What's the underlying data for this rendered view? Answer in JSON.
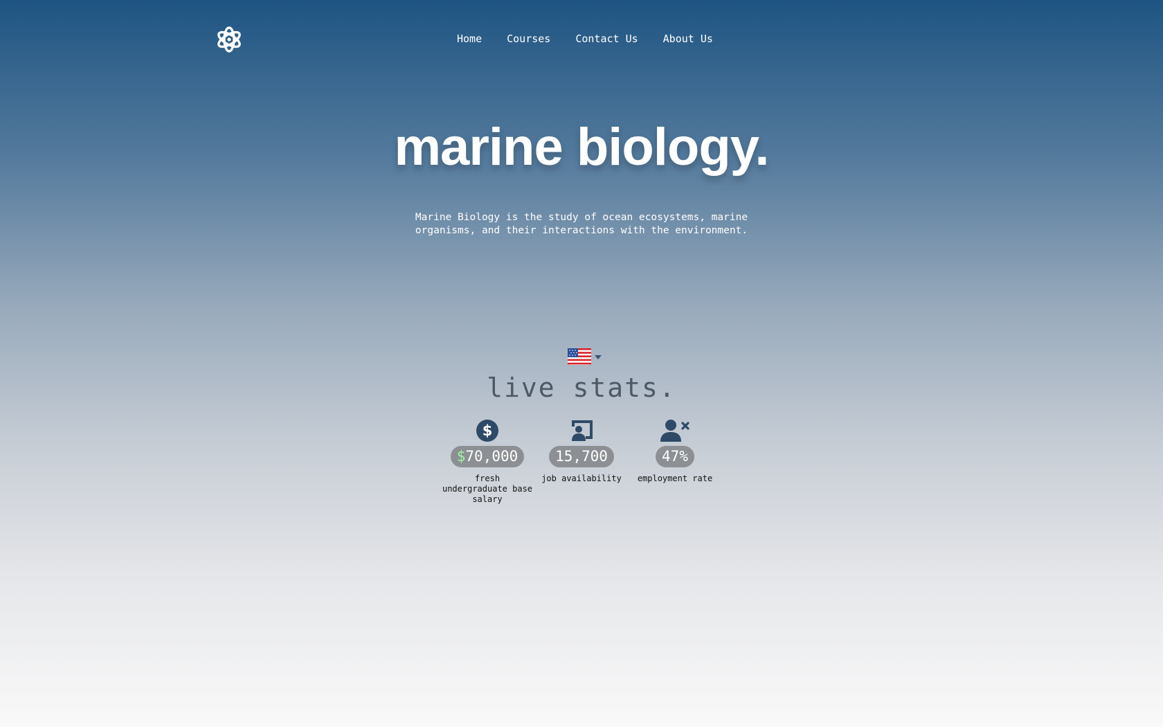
{
  "nav": {
    "items": [
      {
        "label": "Home"
      },
      {
        "label": "Courses"
      },
      {
        "label": "Contact Us"
      },
      {
        "label": "About Us"
      }
    ]
  },
  "hero": {
    "title": "marine biology.",
    "description": "Marine Biology is the study of ocean ecosystems, marine organisms, and their interactions with the environment."
  },
  "stats": {
    "title": "live stats.",
    "country_flag": "🇺🇸",
    "items": [
      {
        "icon": "dollar-circle-icon",
        "currency": "$",
        "value": "70,000",
        "label": "fresh undergraduate base salary"
      },
      {
        "icon": "presenter-board-icon",
        "value": "15,700",
        "label": "job availability"
      },
      {
        "icon": "user-x-icon",
        "value": "47%",
        "label": "employment rate"
      }
    ]
  },
  "colors": {
    "icon": "#2e4a66",
    "pill": "#8c8f93",
    "currency": "#9ff5a2",
    "gradient_top": "#1e5482",
    "gradient_bottom": "#f9f9f9"
  }
}
